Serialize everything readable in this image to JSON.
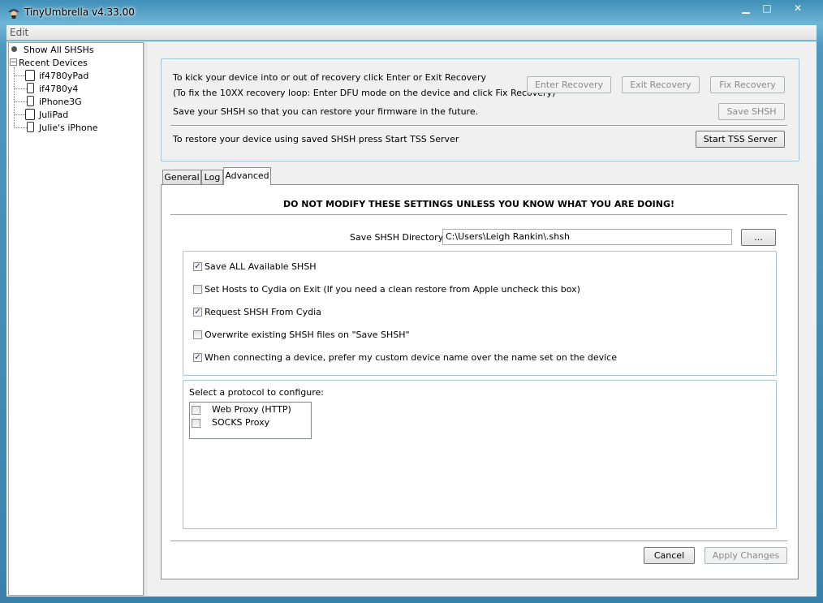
{
  "window": {
    "title": "TinyUmbrella v4.33.00",
    "minimize_symbol": "▁",
    "maximize_symbol": "□",
    "close_symbol": "✕"
  },
  "menu": {
    "items": [
      {
        "label": "Edit"
      }
    ]
  },
  "tree": {
    "root_items": [
      {
        "label": "Show All SHSHs",
        "icon": "dot-icon"
      },
      {
        "label": "Recent Devices",
        "icon": "collapse-box-icon",
        "expander": "⊟"
      }
    ],
    "devices": [
      {
        "label": "if4780yPad",
        "icon": "ipad-icon"
      },
      {
        "label": "if4780y4",
        "icon": "iphone-icon"
      },
      {
        "label": "iPhone3G",
        "icon": "iphone-icon"
      },
      {
        "label": "JuliPad",
        "icon": "ipad-icon"
      },
      {
        "label": "Julie's iPhone",
        "icon": "iphone-icon"
      }
    ]
  },
  "recovery": {
    "line1": "To kick your device into or out of recovery click Enter or Exit Recovery",
    "line2": "(To fix the 10XX recovery loop: Enter DFU mode on the device and click Fix Recovery)",
    "line3": "Save your SHSH so that you can restore your firmware in the future.",
    "line4": "To restore your device using saved SHSH press Start TSS Server",
    "enter_recovery": "Enter Recovery",
    "exit_recovery": "Exit Recovery",
    "fix_recovery": "Fix Recovery",
    "save_shsh": "Save SHSH",
    "start_tss": "Start TSS Server"
  },
  "tabs": [
    {
      "label": "General",
      "active": false
    },
    {
      "label": "Log",
      "active": false
    },
    {
      "label": "Advanced",
      "active": true
    }
  ],
  "advanced": {
    "warning": "DO NOT MODIFY THESE SETTINGS UNLESS YOU KNOW WHAT YOU ARE DOING!",
    "dir_label": "Save SHSH Directory:",
    "dir_value": "C:\\Users\\Leigh Rankin\\.shsh",
    "browse_label": "...",
    "options": [
      {
        "label": "Save ALL Available SHSH",
        "checked": true
      },
      {
        "label": "Set Hosts to Cydia on Exit (If you need a clean restore from Apple uncheck this box)",
        "checked": false
      },
      {
        "label": "Request SHSH From Cydia",
        "checked": true
      },
      {
        "label": "Overwrite existing SHSH files on \"Save SHSH\"",
        "checked": false
      },
      {
        "label": "When connecting a device, prefer my custom device name over the name set on the device",
        "checked": true
      }
    ],
    "protocol_label": "Select a protocol to configure:",
    "protocols": [
      {
        "label": "Web Proxy (HTTP)",
        "checked": false
      },
      {
        "label": "SOCKS Proxy",
        "checked": false
      }
    ],
    "cancel": "Cancel",
    "apply": "Apply Changes"
  },
  "check_symbol": "✓",
  "colors": {
    "frame": "#3f8fb8",
    "groupbox_border": "#a3c3d8",
    "disabled_text": "#8a8a8a"
  }
}
